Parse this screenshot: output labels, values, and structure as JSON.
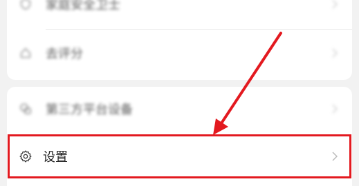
{
  "menu": {
    "items": [
      {
        "label": "家庭安全卫士",
        "icon": "shield-icon",
        "blurred": true
      },
      {
        "label": "去评分",
        "icon": "house-icon",
        "blurred": true
      },
      {
        "label": "第三方平台设备",
        "icon": "devices-icon",
        "blurred": true
      },
      {
        "label": "设置",
        "icon": "gear-icon",
        "blurred": false
      }
    ]
  },
  "annotation": {
    "highlight_color": "#e3191f",
    "arrow_color": "#e3191f"
  },
  "colors": {
    "background": "#f2f2f2",
    "card": "#ffffff",
    "text": "#222222",
    "chevron": "#bbbbbb"
  }
}
